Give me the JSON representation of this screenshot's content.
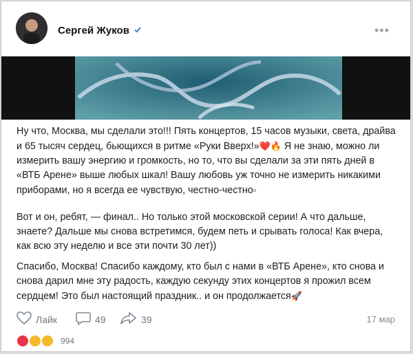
{
  "post": {
    "author": "Сергей Жуков",
    "date": "17 мар",
    "paragraphs": {
      "p1": "Ну что, Москва, мы сделали это!!! Пять концертов, 15 часов музыки, света, драйва и 65 тысяч сердец, бьющихся в ритме «Руки Вверх!»",
      "p1b": " Я не знаю, можно ли измерить вашу энергию и громкость, но то, что вы сделали за эти пять дней в «ВТБ Арене» выше любых шкал! Вашу любовь уж точно не измерить никакими приборами, но я всегда ее чувствую, честно-честно",
      "p2": "Вот и он, ребят, — финал.. Но только этой московской серии! А что дальше, знаете? Дальше мы снова встретимся, будем петь и срывать голоса! Как вчера, как всю эту неделю и все эти почти 30 лет))",
      "p3": "Спасибо, Москва! Спасибо каждому, кто был с нами в «ВТБ Арене», кто снова и снова дарил мне эту радость, каждую секунду этих концертов я прожил всем сердцем! Это был настоящий праздник.. и он продолжается"
    },
    "actions": {
      "like_label": "Лайк",
      "comments": "49",
      "shares": "39"
    },
    "reactions_count": "994"
  },
  "colors": {
    "accent": "#3f7fd0",
    "muted": "#818c99"
  },
  "icons": [
    "verified-icon",
    "more-icon",
    "heart-outline-icon",
    "comment-icon",
    "share-icon",
    "heart-reaction-icon",
    "star-eyes-reaction-icon",
    "laughing-reaction-icon",
    "rocket-emoji",
    "fire-emoji",
    "heart-emoji"
  ]
}
